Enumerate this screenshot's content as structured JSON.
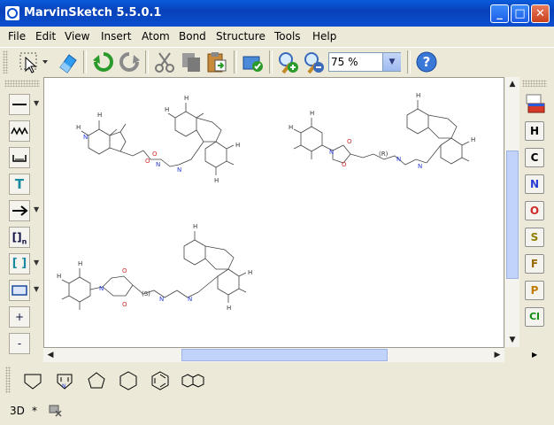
{
  "window": {
    "title": "MarvinSketch 5.5.0.1",
    "minimize": "_",
    "maximize": "□",
    "close": "✕"
  },
  "menu": [
    {
      "label": "File",
      "name": "menu-file"
    },
    {
      "label": "Edit",
      "name": "menu-edit"
    },
    {
      "label": "View",
      "name": "menu-view"
    },
    {
      "label": "Insert",
      "name": "menu-insert"
    },
    {
      "label": "Atom",
      "name": "menu-atom"
    },
    {
      "label": "Bond",
      "name": "menu-bond"
    },
    {
      "label": "Structure",
      "name": "menu-structure"
    },
    {
      "label": "Tools",
      "name": "menu-tools"
    },
    {
      "label": "Help",
      "name": "menu-help"
    }
  ],
  "toolbar": {
    "icons": [
      "selection-icon",
      "eraser-icon",
      "undo-icon",
      "redo-icon",
      "cut-icon",
      "copy-icon",
      "paste-icon",
      "clean-icon",
      "zoom-in-icon",
      "zoom-out-icon",
      "help-icon"
    ],
    "zoom": "75 %",
    "help": "?"
  },
  "left_tools": {
    "text": "T",
    "bracket_n": "[]",
    "bracket_sub": "n",
    "bracket": "[ ]",
    "plus": "+",
    "minus": "-"
  },
  "elements": [
    "H",
    "C",
    "N",
    "O",
    "S",
    "F",
    "P",
    "Cl"
  ],
  "element_colors": {
    "H": "#000000",
    "C": "#000000",
    "N": "#2a3bd6",
    "O": "#d12a2a",
    "S": "#8f7f00",
    "F": "#9a6a00",
    "P": "#c07a00",
    "Cl": "#0c8c0c"
  },
  "canvas": {
    "mol1": {
      "n": "N",
      "o": "O",
      "h": "H"
    },
    "mol2": {
      "n": "N",
      "o": "O",
      "h": "H",
      "stereo": "(R)"
    },
    "mol3": {
      "n": "N",
      "o": "O",
      "h": "H",
      "stereo": "(S)"
    }
  },
  "status": {
    "mode": "3D",
    "marker": "*"
  }
}
